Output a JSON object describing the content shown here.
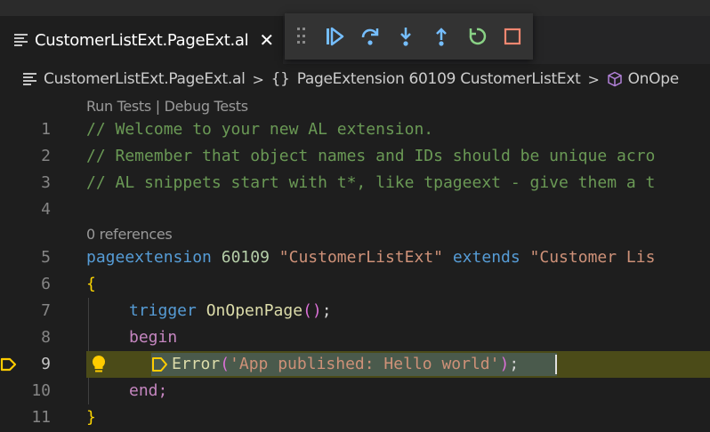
{
  "tab": {
    "title": "CustomerListExt.PageExt.al",
    "close_glyph": "✕"
  },
  "debug_toolbar": {
    "buttons": [
      {
        "name": "continue",
        "icon": "continue-icon",
        "color": "#75beff"
      },
      {
        "name": "step-over",
        "icon": "step-over-icon",
        "color": "#75beff"
      },
      {
        "name": "step-into",
        "icon": "step-into-icon",
        "color": "#75beff"
      },
      {
        "name": "step-out",
        "icon": "step-out-icon",
        "color": "#75beff"
      },
      {
        "name": "restart",
        "icon": "restart-icon",
        "color": "#89d185"
      },
      {
        "name": "stop",
        "icon": "stop-icon",
        "color": "#f48771"
      }
    ]
  },
  "breadcrumb": {
    "file": "CustomerListExt.PageExt.al",
    "separator": ">",
    "braces": "{}",
    "symbol": "PageExtension 60109 CustomerListExt",
    "method": "OnOpe"
  },
  "codelens": {
    "tests": "Run Tests | Debug Tests",
    "references": "0 references"
  },
  "lines": [
    {
      "num": "1",
      "text": "// Welcome to your new AL extension."
    },
    {
      "num": "2",
      "text": "// Remember that object names and IDs should be unique acro"
    },
    {
      "num": "3",
      "text": "// AL snippets start with t*, like tpageext - give them a t"
    },
    {
      "num": "4",
      "text": ""
    },
    {
      "num": "5",
      "keyword": "pageextension",
      "id": "60109",
      "name": "\"CustomerListExt\"",
      "extends": "extends",
      "target": "\"Customer Lis"
    },
    {
      "num": "6",
      "text": "{"
    },
    {
      "num": "7",
      "keyword": "trigger",
      "fn": "OnOpenPage",
      "rest": ";"
    },
    {
      "num": "8",
      "text": "begin"
    },
    {
      "num": "9",
      "fn": "Error",
      "str": "'App published: Hello world'",
      "rest": ";"
    },
    {
      "num": "10",
      "text": "end;"
    },
    {
      "num": "11",
      "text": "}"
    }
  ],
  "colors": {
    "breakpoint_arrow": "#ffcc00",
    "current_line_bg": "#4b4b18",
    "selection_bg": "#4a5a4c",
    "keyword": "#569cd6",
    "comment": "#6a9955",
    "string": "#ce9178",
    "function": "#dcdcaa",
    "control": "#c586c0"
  }
}
